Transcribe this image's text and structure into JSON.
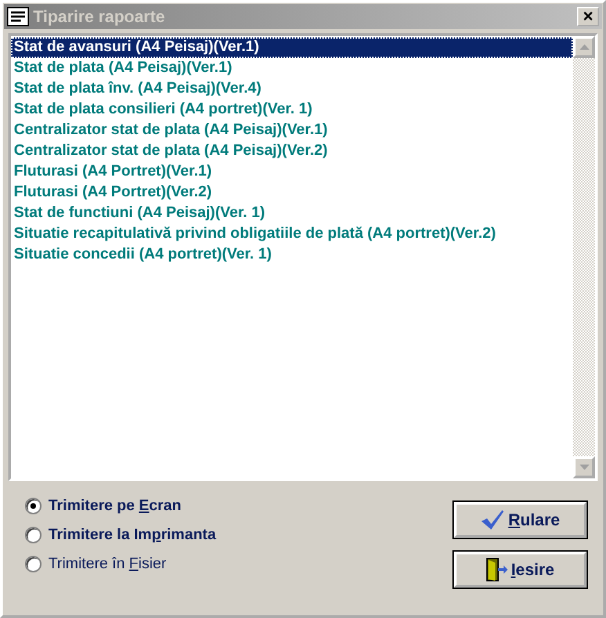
{
  "window": {
    "title": "Tiparire rapoarte",
    "close": "×"
  },
  "reports": [
    {
      "label": "Stat de avansuri (A4 Peisaj)(Ver.1)",
      "selected": true
    },
    {
      "label": "Stat de plata (A4 Peisaj)(Ver.1)",
      "selected": false
    },
    {
      "label": "Stat de plata înv. (A4 Peisaj)(Ver.4)",
      "selected": false
    },
    {
      "label": "Stat de plata consilieri (A4 portret)(Ver. 1)",
      "selected": false
    },
    {
      "label": "Centralizator stat de plata (A4 Peisaj)(Ver.1)",
      "selected": false
    },
    {
      "label": "Centralizator stat de plata (A4 Peisaj)(Ver.2)",
      "selected": false
    },
    {
      "label": "Fluturasi (A4 Portret)(Ver.1)",
      "selected": false
    },
    {
      "label": "Fluturasi (A4 Portret)(Ver.2)",
      "selected": false
    },
    {
      "label": "Stat de functiuni (A4 Peisaj)(Ver. 1)",
      "selected": false
    },
    {
      "label": "Situatie recapitulativă privind obligatiile de plată (A4 portret)(Ver.2)",
      "selected": false
    },
    {
      "label": "Situatie concedii (A4 portret)(Ver. 1)",
      "selected": false
    }
  ],
  "output_options": [
    {
      "label": {
        "before": "Trimitere pe ",
        "accel": "E",
        "after": "cran"
      },
      "selected": true,
      "bold": true
    },
    {
      "label": {
        "before": "Trimitere la Im",
        "accel": "p",
        "after": "rimanta"
      },
      "selected": false,
      "bold": true
    },
    {
      "label": {
        "before": "Trimitere în ",
        "accel": "F",
        "after": "isier"
      },
      "selected": false,
      "bold": false
    }
  ],
  "buttons": [
    {
      "kind": "run",
      "label": {
        "accel": "R",
        "after": "ulare"
      }
    },
    {
      "kind": "exit",
      "label": {
        "accel": "I",
        "after": "esire"
      }
    }
  ]
}
